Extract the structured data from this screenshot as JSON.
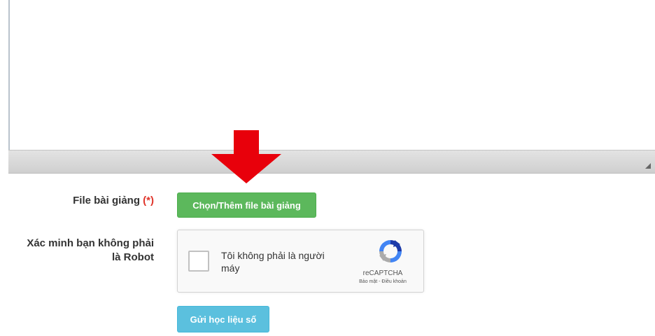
{
  "form": {
    "file_label": "File bài giảng",
    "required_marker": "(*)",
    "file_button": "Chọn/Thêm file bài giảng",
    "verify_label_line1": "Xác minh bạn không phải",
    "verify_label_line2": "là Robot",
    "submit_button": "Gửi học liệu số"
  },
  "recaptcha": {
    "checkbox_text_line1": "Tôi không phải là người",
    "checkbox_text_line2": "máy",
    "brand": "reCAPTCHA",
    "terms": "Bảo mật - Điều khoản"
  },
  "colors": {
    "green_button": "#5cb85c",
    "blue_button": "#5bc0de",
    "arrow": "#e8000b",
    "required": "#e0352b"
  },
  "icons": {
    "annotation": "down-arrow-icon",
    "recaptcha_logo": "recaptcha-logo-icon",
    "resize": "resize-grip-icon"
  }
}
